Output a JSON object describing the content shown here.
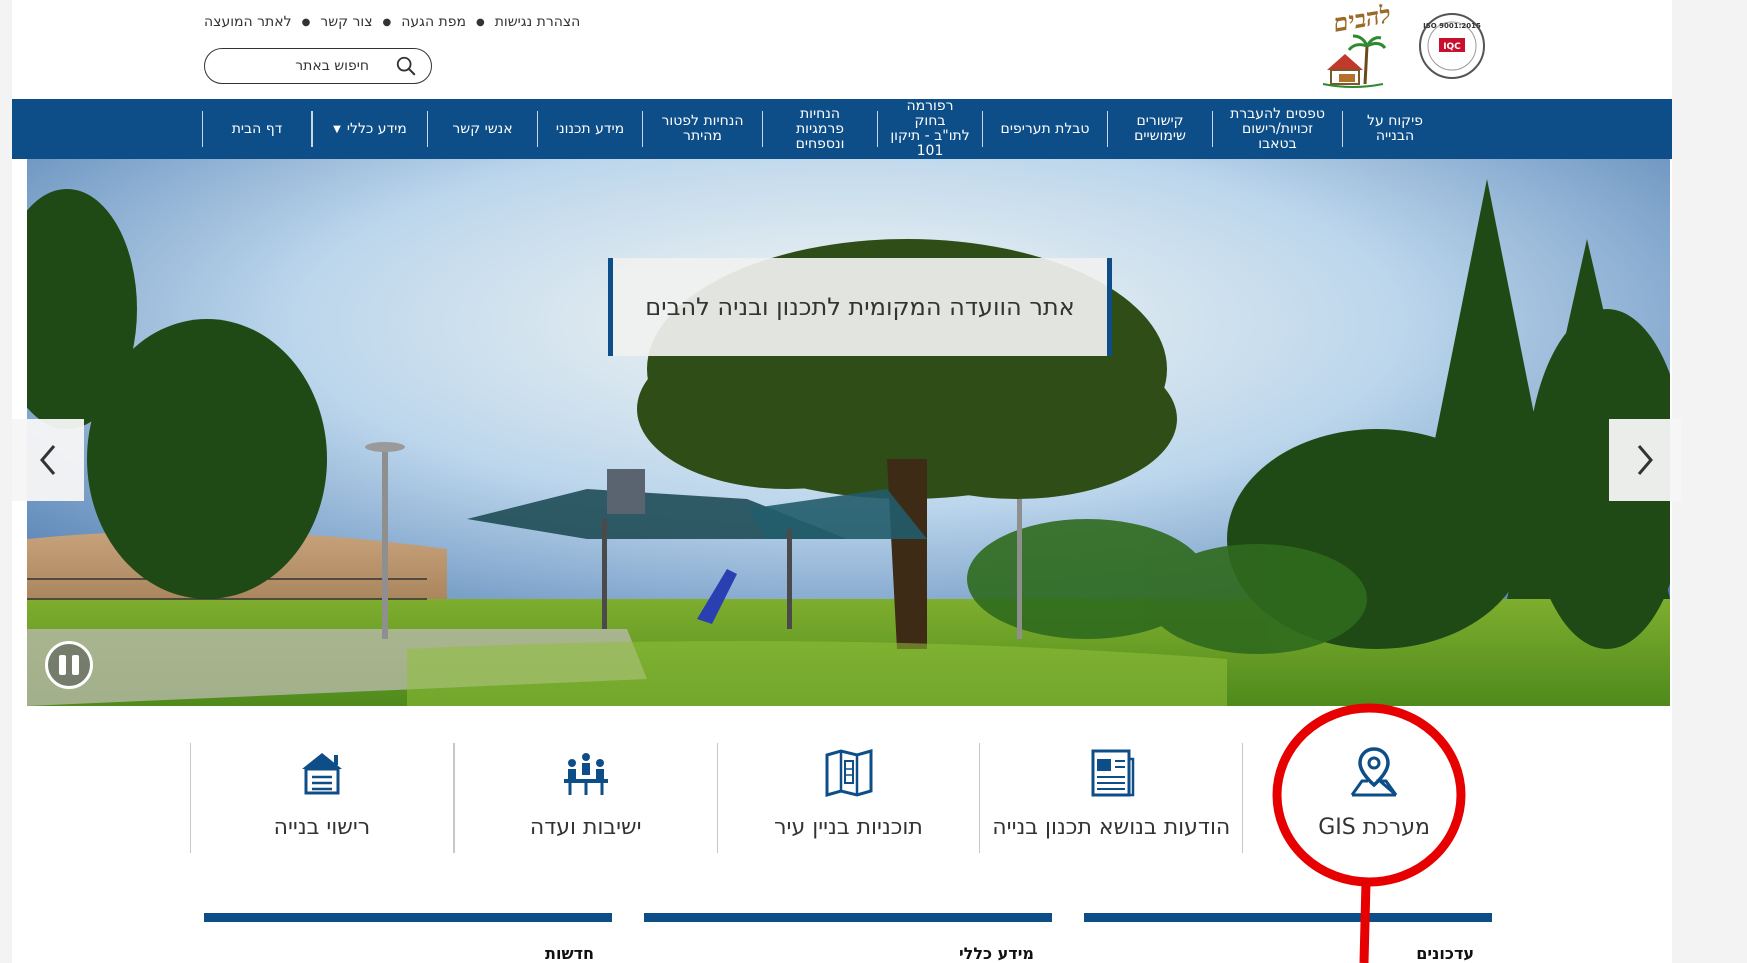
{
  "top_links": [
    {
      "label": "לאתר המועצה"
    },
    {
      "label": "צור קשר"
    },
    {
      "label": "מפת הגעה"
    },
    {
      "label": "הצהרת נגישות"
    }
  ],
  "search": {
    "placeholder": "חיפוש באתר"
  },
  "logo": {
    "brand": "להבים",
    "iso": "ISO 9001:2015",
    "iso_mark": "IQC"
  },
  "nav": {
    "items": [
      {
        "label": "דף הבית"
      },
      {
        "label": "מידע כללי",
        "has_dropdown": true
      },
      {
        "label": "אנשי קשר"
      },
      {
        "label": "מידע תכנוני"
      },
      {
        "label": "הנחיות לפטור\nמהיתר"
      },
      {
        "label": "הנחיות\nפרמגיות\nונספחים"
      },
      {
        "label": "רפורמה בחוק\nלתו\"ב - תיקון\n101"
      },
      {
        "label": "טבלת תעריפים"
      },
      {
        "label": "קישורים\nשימושיים"
      },
      {
        "label": "טפסים להעברת\nזכויות/רישום\nבטאבו"
      },
      {
        "label": "פיקוח על\nהבנייה"
      }
    ]
  },
  "hero": {
    "caption": "אתר הוועדה המקומית לתכנון ובניה להבים"
  },
  "quick_links": [
    {
      "label": "רישוי בנייה",
      "icon": "building-permit-icon"
    },
    {
      "label": "ישיבות ועדה",
      "icon": "committee-meeting-icon"
    },
    {
      "label": "תוכניות בניין עיר",
      "icon": "city-plan-icon"
    },
    {
      "label": "הודעות בנושא תכנון בנייה",
      "icon": "notices-icon"
    },
    {
      "label": "מערכת GIS",
      "icon": "gis-map-icon"
    }
  ],
  "panels": {
    "updates": "עדכונים",
    "info": "מידע כללי",
    "news": "חדשות"
  },
  "colors": {
    "primary": "#0e4e88",
    "annotation": "#e60000"
  }
}
